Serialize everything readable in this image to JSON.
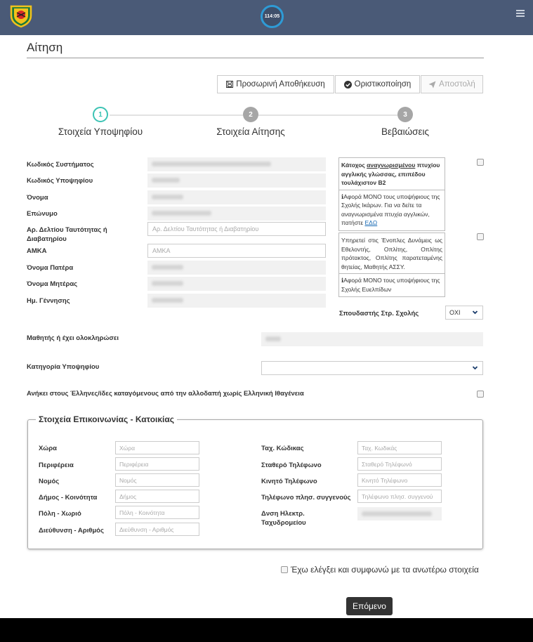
{
  "header": {
    "timer": "114:05"
  },
  "page": {
    "title": "Αίτηση"
  },
  "toolbar": {
    "temp_save": "Προσωρινή Αποθήκευση",
    "finalize": "Οριστικοποίηση",
    "send": "Αποστολή"
  },
  "steps": [
    {
      "num": "1",
      "label": "Στοιχεία Υποψηφίου"
    },
    {
      "num": "2",
      "label": "Στοιχεία Αίτησης"
    },
    {
      "num": "3",
      "label": "Βεβαιώσεις"
    }
  ],
  "candidate": {
    "system_code": "Κωδικός Συστήματος",
    "candidate_code": "Κωδικός Υποψηφίου",
    "first_name": "Όνομα",
    "last_name": "Επώνυμο",
    "id_number": "Αρ. Δελτίου Ταυτότητας ή Διαβατηρίου",
    "id_placeholder": "Αρ. Δελτίου Ταυτότητας ή Διαβατηρίου",
    "amka": "ΑΜΚΑ",
    "amka_placeholder": "ΑΜΚΑ",
    "father_name": "Όνομα Πατέρα",
    "mother_name": "Όνομα Μητέρας",
    "birth_date": "Ημ. Γέννησης",
    "student_completed": "Μαθητής ή έχει ολοκληρώσει",
    "category": "Κατηγορία Υποψηφίου",
    "greek_descent": "Ανήκει στους Έλληνες/ίδες καταγόμενους από την αλλοδαπή χωρίς Ελληνική Ιθαγένεια"
  },
  "info1": {
    "p1": "Κάτοχος ",
    "p1_u": "αναγνωρισμένου",
    "p1_rest": " πτυχίου αγγλικής γλώσσας, επιπέδου τουλάχιστον Β2",
    "p2_icon": "ℹ",
    "p2": "Αφορά ΜΟΝΟ τους υποψήφιους της Σχολής Ικάρων. Για να δείτε τα αναγνωρισμένα πτυχία αγγλικών, πατήστε ",
    "link": "ΕΔΩ"
  },
  "info2": {
    "p1": "Υπηρετεί στις Ένοπλες Δυνάμεις ως Εθελοντής, Οπλίτης, Οπλίτης πρότακτος, Οπλίτης παρατεταμένης θητείας, Μαθητής ΑΣΣΥ.",
    "p2_icon": "ℹ",
    "p2": "Αφορά ΜΟΝΟ τους υποψήφιους της Σχολής Ευελπίδων"
  },
  "military": {
    "label": "Σπουδαστής Στρ. Σχολής",
    "value": "ΟΧΙ"
  },
  "contact": {
    "legend": "Στοιχεία Επικοινωνίας - Κατοικίας",
    "left": [
      {
        "label": "Χώρα",
        "placeholder": "Χώρα"
      },
      {
        "label": "Περιφέρεια",
        "placeholder": "Περιφέρεια"
      },
      {
        "label": "Νομός",
        "placeholder": "Νομός"
      },
      {
        "label": "Δήμος - Κοινότητα",
        "placeholder": "Δήμος"
      },
      {
        "label": "Πόλη - Χωριό",
        "placeholder": "Πόλη - Κοινότητα"
      },
      {
        "label": "Διεύθυνση - Αριθμός",
        "placeholder": "Διεύθυνση - Αριθμός"
      }
    ],
    "right": [
      {
        "label": "Ταχ. Κώδικας",
        "placeholder": "Ταχ. Κωδικάς"
      },
      {
        "label": "Σταθερό Τηλέφωνο",
        "placeholder": "Σταθερό Τηλέφωνό"
      },
      {
        "label": "Κινητό Τηλέφωνο",
        "placeholder": "Κινητό Τηλέφωνο"
      },
      {
        "label": "Τηλέφωνο πλησ. συγγενούς",
        "placeholder": "Τηλέφωνο πλησ. συγγενού"
      },
      {
        "label": "Δνση Ηλεκτρ. Ταχυδρομείου",
        "placeholder": ""
      }
    ]
  },
  "agree": {
    "label": "Έχω ελέγξει και συμφωνώ με τα ανωτέρω στοιχεία"
  },
  "next": {
    "label": "Επόμενο"
  },
  "colors": {
    "header": "#4a5a77",
    "accent": "#3cc3b4",
    "timer_ring": "#2e9bd6"
  }
}
